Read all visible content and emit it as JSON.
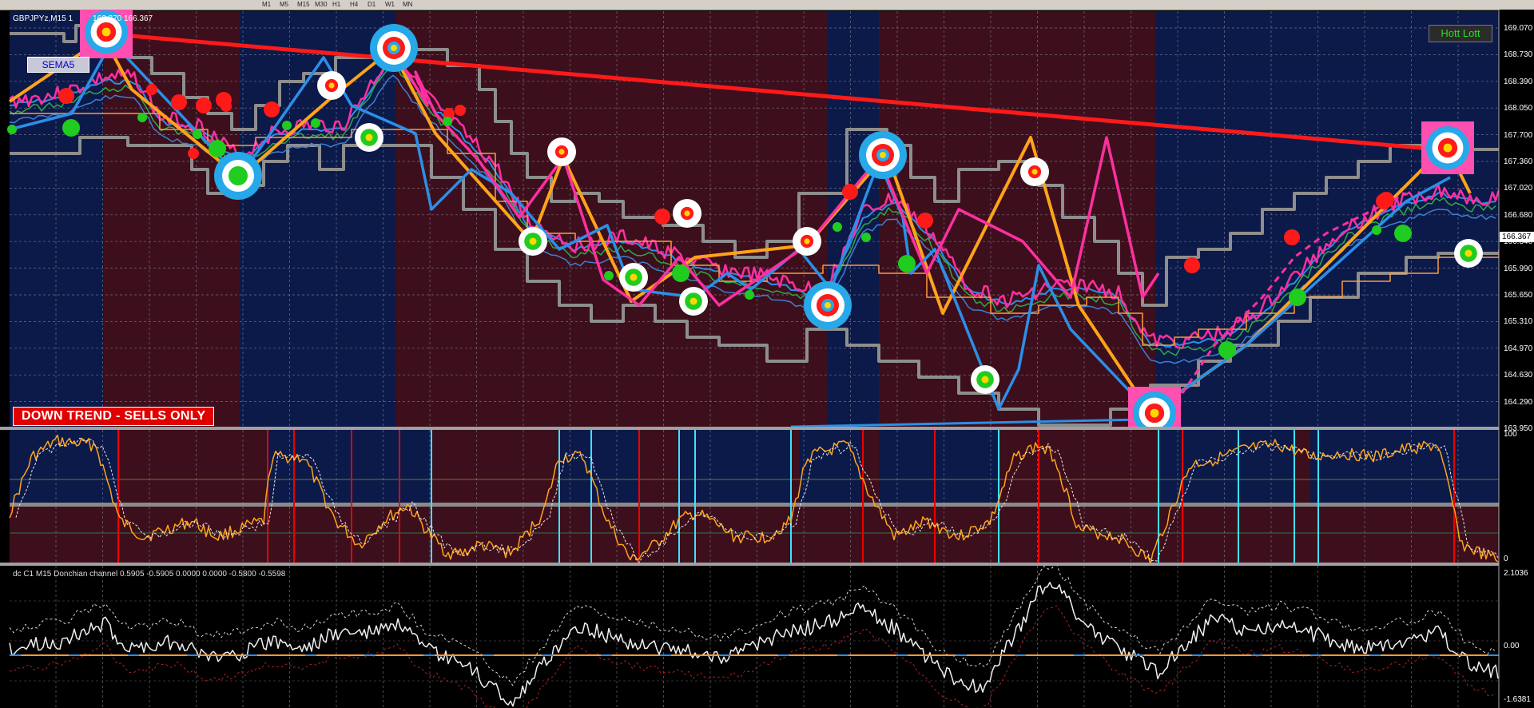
{
  "toolbar": {
    "timeframes": [
      "M1",
      "M5",
      "M15",
      "M30",
      "H1",
      "H4",
      "D1",
      "W1",
      "MN"
    ]
  },
  "chart": {
    "symbol_title": "GBPJPYz,M15  1",
    "ohlc_partial": "166.270 166.367",
    "current_price": "166.367",
    "price_axis": [
      "169.070",
      "168.730",
      "168.390",
      "168.050",
      "167.700",
      "167.360",
      "167.020",
      "166.680",
      "166.340",
      "165.990",
      "165.650",
      "165.310",
      "164.970",
      "164.630",
      "164.290",
      "163.950"
    ],
    "trend_banner": "DOWN TREND - SELLS ONLY",
    "sema_label": "SEMA5",
    "hott_button": "Hott Lott"
  },
  "oscillator": {
    "axis": [
      "100",
      "0"
    ]
  },
  "donchian": {
    "title": "dc C1 M15 Donchian channel 0.5905 -0.5905 0.0000 0.0000 -0.5800 -0.5598",
    "axis": [
      "2.1036",
      "0.00",
      "-1.6381"
    ]
  },
  "colors": {
    "bear_bg": "#3d0f1c",
    "bull_bg": "#0c1a4a",
    "trendline": "#ff1a1a",
    "zigzag_orange": "#ffa31a",
    "zigzag_blue": "#2b8fe8",
    "zigzag_pink": "#ff2fa0",
    "channel_gray": "#8e8e8e"
  }
}
